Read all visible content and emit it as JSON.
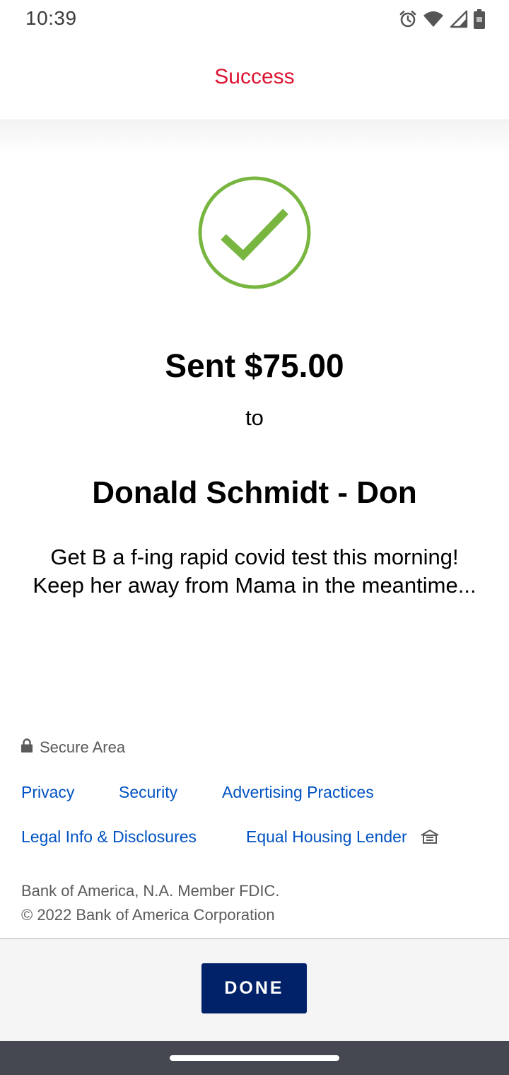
{
  "status_bar": {
    "time": "10:39",
    "icons": [
      "alarm-icon",
      "wifi-icon",
      "signal-icon",
      "battery-icon"
    ]
  },
  "header": {
    "title": "Success"
  },
  "confirmation": {
    "icon": "checkmark-icon",
    "amount_text": "Sent $75.00",
    "to_text": "to",
    "recipient": "Donald Schmidt - Don",
    "memo": "Get B a f-ing rapid covid test this morning! Keep her away from Mama in the meantime..."
  },
  "footer": {
    "secure_label": "Secure Area",
    "links": {
      "privacy": "Privacy",
      "security": "Security",
      "advertising": "Advertising Practices",
      "legal": "Legal Info & Disclosures",
      "equal_housing": "Equal Housing Lender"
    },
    "legal_line1": "Bank of America, N.A. Member FDIC.",
    "legal_line2": "© 2022 Bank of America Corporation"
  },
  "actions": {
    "done_label": "DONE"
  },
  "colors": {
    "header_title": "#dc1431",
    "check_green": "#78b640",
    "link_blue": "#0052c2",
    "done_button": "#012169"
  }
}
